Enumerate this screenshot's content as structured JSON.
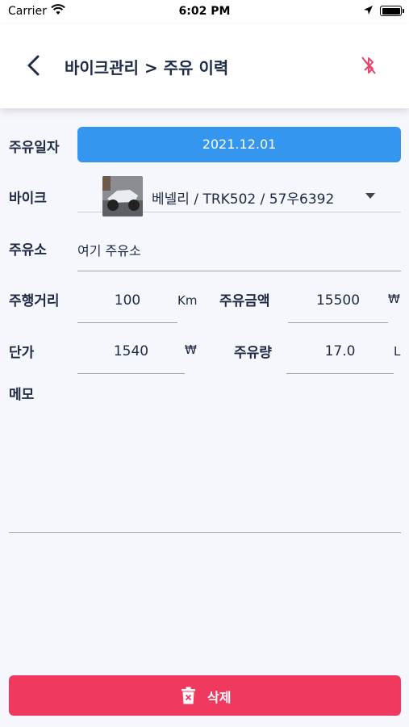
{
  "status_bar": {
    "carrier": "Carrier",
    "time": "6:02 PM"
  },
  "nav": {
    "title": "바이크관리 > 주유 이력",
    "back_icon": "chevron-left-icon",
    "right_icon": "bluetooth-disabled-icon",
    "right_icon_color": "#e8456b"
  },
  "form": {
    "date_label": "주유일자",
    "date_value": "2021.12.01",
    "bike_label": "바이크",
    "bike_value": "베넬리 / TRK502 / 57우6392",
    "station_label": "주유소",
    "station_value": "여기 주유소",
    "distance_label": "주행거리",
    "distance_value": "100",
    "distance_unit": "Km",
    "amount_label": "주유금액",
    "amount_value": "15500",
    "amount_unit": "₩",
    "price_label": "단가",
    "price_value": "1540",
    "price_unit": "₩",
    "volume_label": "주유량",
    "volume_value": "17.0",
    "volume_unit": "L",
    "memo_label": "메모",
    "memo_value": ""
  },
  "actions": {
    "delete_label": "삭제",
    "delete_icon": "trash-icon"
  },
  "colors": {
    "primary": "#3596ef",
    "danger": "#f0395f",
    "text": "#1f2a44",
    "background": "#f5f7fc"
  }
}
